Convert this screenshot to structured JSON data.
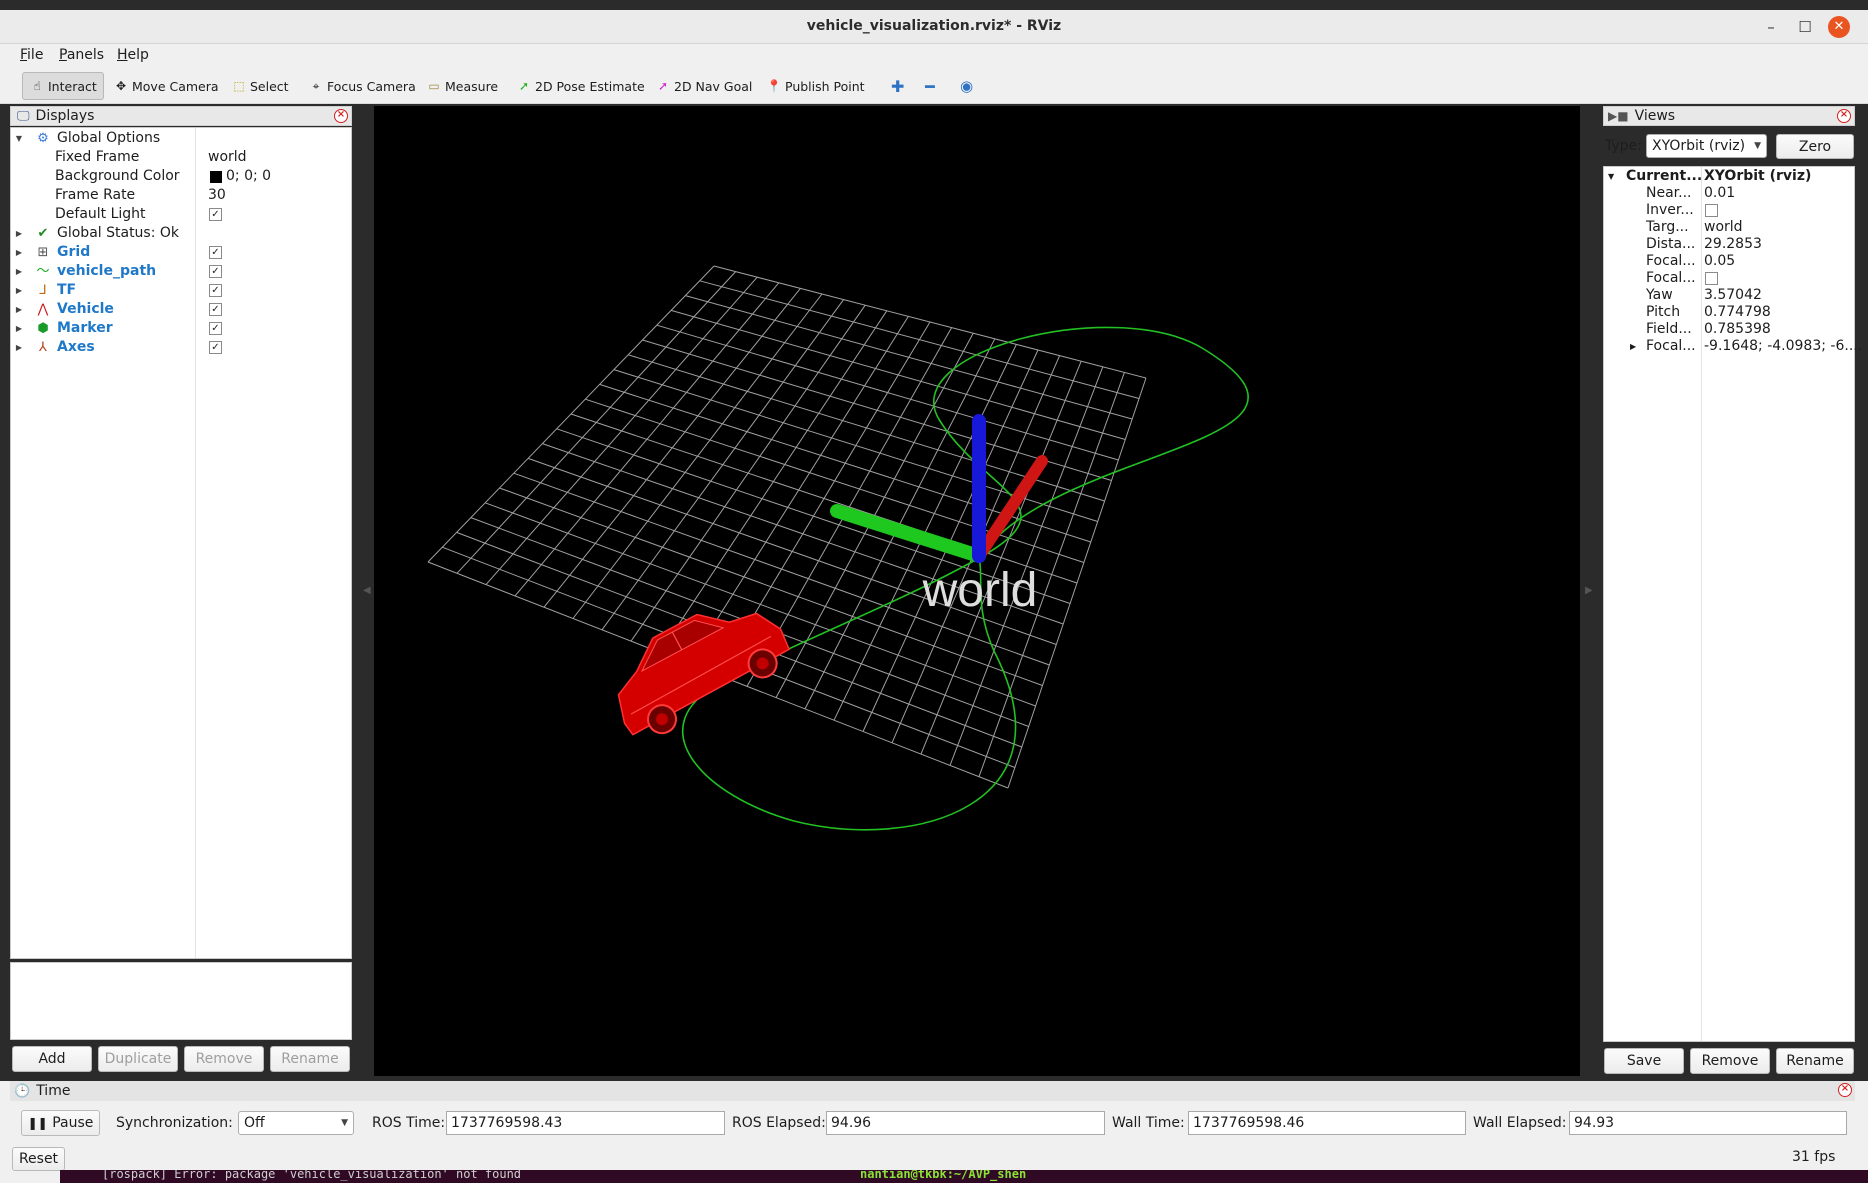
{
  "window": {
    "title": "vehicle_visualization.rviz* - RViz"
  },
  "menu": [
    "File",
    "Panels",
    "Help"
  ],
  "toolbar": {
    "interact": "Interact",
    "move_camera": "Move Camera",
    "select": "Select",
    "focus_camera": "Focus Camera",
    "measure": "Measure",
    "pose_estimate": "2D Pose Estimate",
    "nav_goal": "2D Nav Goal",
    "publish_point": "Publish Point"
  },
  "displays": {
    "title": "Displays",
    "global_options": "Global Options",
    "fixed_frame_label": "Fixed Frame",
    "fixed_frame_value": "world",
    "bg_color_label": "Background Color",
    "bg_color_value": "0; 0; 0",
    "frame_rate_label": "Frame Rate",
    "frame_rate_value": "30",
    "default_light_label": "Default Light",
    "global_status": "Global Status: Ok",
    "items": [
      "Grid",
      "vehicle_path",
      "TF",
      "Vehicle",
      "Marker",
      "Axes"
    ],
    "buttons": {
      "add": "Add",
      "duplicate": "Duplicate",
      "remove": "Remove",
      "rename": "Rename"
    }
  },
  "viewport": {
    "frame_label": "world"
  },
  "views": {
    "title": "Views",
    "type_label": "Type:",
    "type_value": "XYOrbit (rviz)",
    "zero": "Zero",
    "current_label": "Current...",
    "current_value": "XYOrbit (rviz)",
    "props": [
      {
        "label": "Near...",
        "value": "0.01"
      },
      {
        "label": "Inver...",
        "value": ""
      },
      {
        "label": "Targ...",
        "value": "world"
      },
      {
        "label": "Dista...",
        "value": "29.2853"
      },
      {
        "label": "Focal...",
        "value": "0.05"
      },
      {
        "label": "Focal...",
        "value": ""
      },
      {
        "label": "Yaw",
        "value": "3.57042"
      },
      {
        "label": "Pitch",
        "value": "0.774798"
      },
      {
        "label": "Field...",
        "value": "0.785398"
      },
      {
        "label": "Focal...",
        "value": "-9.1648; -4.0983; -6...."
      }
    ],
    "buttons": {
      "save": "Save",
      "remove": "Remove",
      "rename": "Rename"
    }
  },
  "time": {
    "title": "Time",
    "pause": "Pause",
    "sync_label": "Synchronization:",
    "sync_value": "Off",
    "ros_time_label": "ROS Time:",
    "ros_time_value": "1737769598.43",
    "ros_elapsed_label": "ROS Elapsed:",
    "ros_elapsed_value": "94.96",
    "wall_time_label": "Wall Time:",
    "wall_time_value": "1737769598.46",
    "wall_elapsed_label": "Wall Elapsed:",
    "wall_elapsed_value": "94.93",
    "reset": "Reset",
    "fps": "31 fps"
  },
  "terminal": {
    "left": "[rospack] Error: package 'vehicle_visualization' not found",
    "right": "nantian@tkbk:~/AVP_shen"
  }
}
